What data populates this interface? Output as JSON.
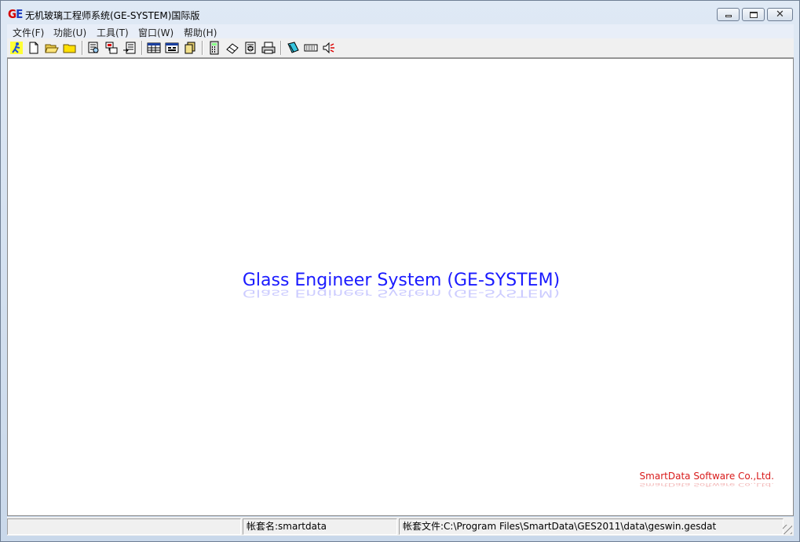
{
  "window": {
    "title": "无机玻璃工程师系统(GE-SYSTEM)国际版",
    "icon_label": {
      "g": "G",
      "e": "E"
    }
  },
  "menu": {
    "items": [
      {
        "label": "文件(F)"
      },
      {
        "label": "功能(U)"
      },
      {
        "label": "工具(T)"
      },
      {
        "label": "窗口(W)"
      },
      {
        "label": "帮助(H)"
      }
    ]
  },
  "toolbar": {
    "buttons": [
      {
        "icon": "run-icon"
      },
      {
        "icon": "new-document-icon"
      },
      {
        "icon": "open-folder-icon"
      },
      {
        "icon": "folder-icon"
      },
      {
        "icon": "search-document-icon"
      },
      {
        "icon": "network-icon"
      },
      {
        "icon": "export-document-icon"
      },
      {
        "icon": "table-icon"
      },
      {
        "icon": "form-icon"
      },
      {
        "icon": "stack-icon"
      },
      {
        "icon": "calculator-icon"
      },
      {
        "icon": "eraser-icon"
      },
      {
        "icon": "report-icon"
      },
      {
        "icon": "print-icon"
      },
      {
        "icon": "notebook-icon"
      },
      {
        "icon": "keyboard-icon"
      },
      {
        "icon": "speaker-icon"
      }
    ]
  },
  "main": {
    "splash_title": "Glass Engineer System (GE-SYSTEM)",
    "company": "SmartData Software Co.,Ltd."
  },
  "status": {
    "cell1": "",
    "account_name": "帐套名:smartdata",
    "account_file": "帐套文件:C:\\Program Files\\SmartData\\GES2011\\data\\geswin.gesdat"
  },
  "colors": {
    "splash_blue": "#1a1aff",
    "company_red": "#d81b1b",
    "title_gradient_top": "#dfe9f5"
  }
}
